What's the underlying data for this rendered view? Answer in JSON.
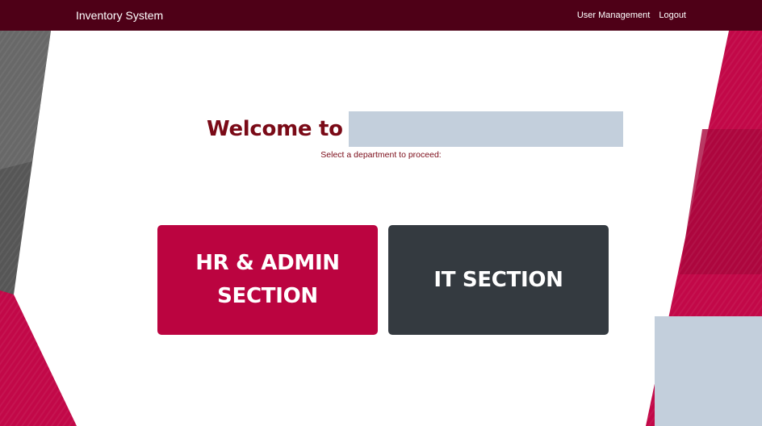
{
  "navbar": {
    "brand": "Inventory System",
    "links": [
      {
        "label": "User Management"
      },
      {
        "label": "Logout"
      }
    ]
  },
  "welcome": {
    "title": "Welcome to",
    "subtitle": "Select a department to proceed:"
  },
  "departments": [
    {
      "label": "HR & ADMIN SECTION",
      "line1": "HR & ADMIN",
      "line2": "SECTION",
      "color": "#bb0440"
    },
    {
      "label": "IT SECTION",
      "color": "#343a40"
    }
  ],
  "colors": {
    "navbar": "#4e0017",
    "accent": "#bb0440",
    "heading": "#7a0a17",
    "dark": "#343a40",
    "placeholder": "#c3cfdc"
  }
}
